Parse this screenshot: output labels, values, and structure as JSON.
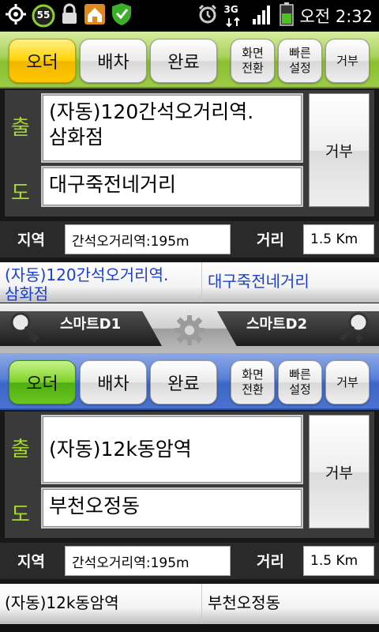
{
  "status_bar": {
    "icons_left": [
      "gps-icon",
      "battery-55-icon",
      "lock-icon",
      "home-app-icon",
      "shield-check-icon"
    ],
    "battery_percent": "55",
    "network_label": "3G",
    "clock": "오전 2:32",
    "icons_right": [
      "alarm-icon",
      "3g-data-icon",
      "signal-icon",
      "battery-charging-icon"
    ]
  },
  "panel1": {
    "tabs": {
      "order": "오더",
      "dispatch": "배차",
      "complete": "완료",
      "screen_switch_line1": "화면",
      "screen_switch_line2": "전환",
      "quick_settings_line1": "빠른",
      "quick_settings_line2": "설정",
      "reject": "거부"
    },
    "origin_label": "출",
    "dest_label": "도",
    "origin_line1": "(자동)120간석오거리역.",
    "origin_line2": "삼화점",
    "destination": "대구죽전네거리",
    "reject_button": "거부",
    "region_label": "지역",
    "region_value": "간석오거리역:195m",
    "distance_label": "거리",
    "distance_value": "1.5 Km",
    "addr_origin_line1": "(자동)120간석오거리역.",
    "addr_origin_line2": "삼화점",
    "addr_destination": "대구죽전네거리"
  },
  "midbar": {
    "left_label": "스마트D1",
    "right_label": "스마트D2"
  },
  "panel2": {
    "tabs": {
      "order": "오더",
      "dispatch": "배차",
      "complete": "완료",
      "screen_switch_line1": "화면",
      "screen_switch_line2": "전환",
      "quick_settings_line1": "빠른",
      "quick_settings_line2": "설정",
      "reject": "거부"
    },
    "origin_label": "출",
    "dest_label": "도",
    "origin": "(자동)12k동암역",
    "destination": "부천오정동",
    "reject_button": "거부",
    "region_label": "지역",
    "region_value": "간석오거리역:195m",
    "distance_label": "거리",
    "distance_value": "1.5 Km",
    "addr_origin": "(자동)12k동암역",
    "addr_destination": "부천오정동"
  },
  "colors": {
    "panel1_accent": "#9ccc47",
    "panel2_accent": "#4a72cf",
    "active_tab_1": "#ffc800",
    "active_tab_2": "#6ac61e",
    "label_green": "#a7d832",
    "address_link_blue": "#1a3fd0"
  }
}
